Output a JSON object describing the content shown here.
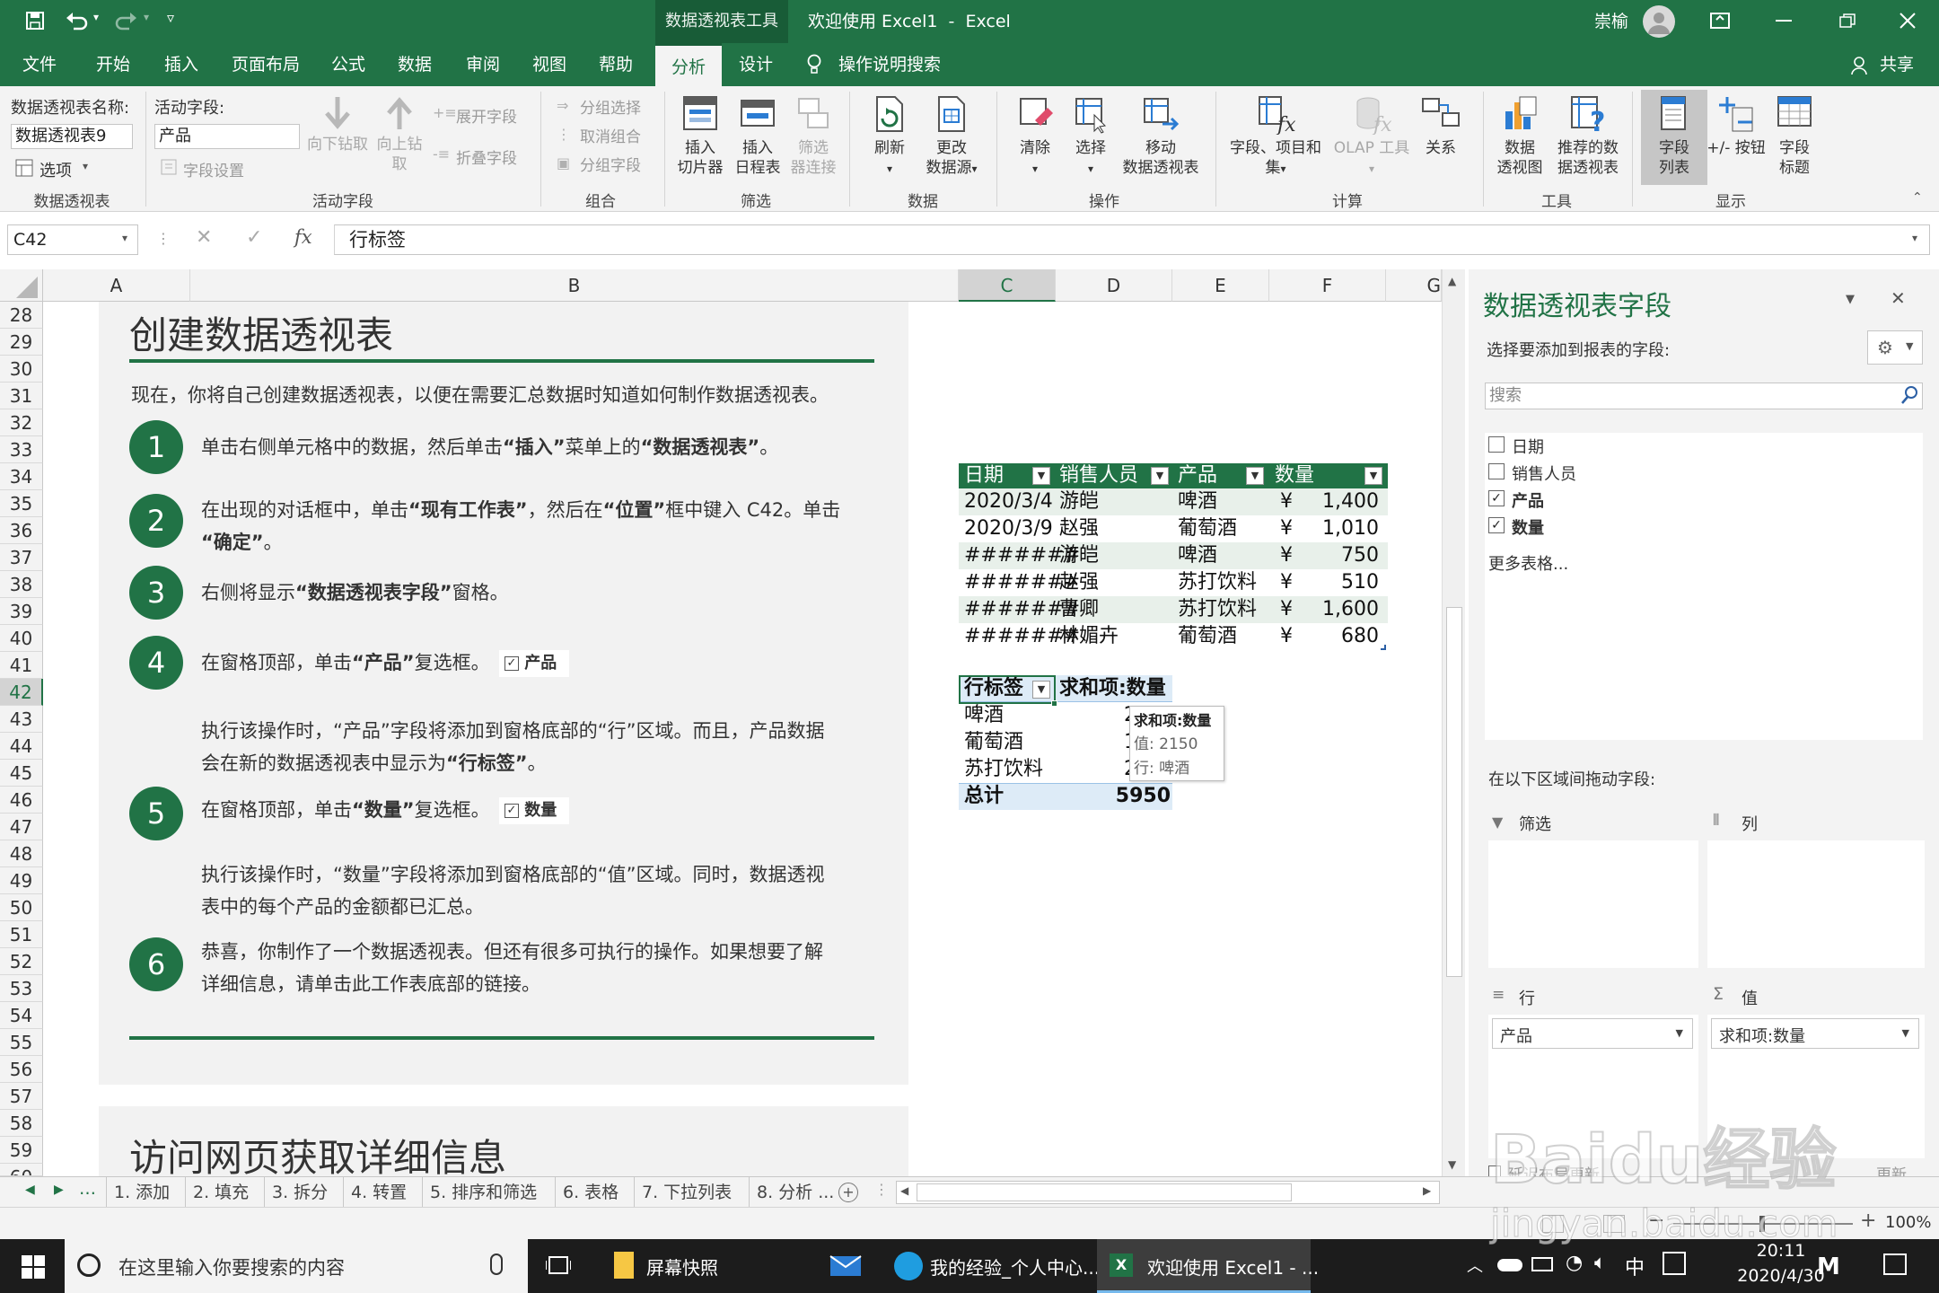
{
  "app": {
    "context_tab": "数据透视表工具",
    "window_title": "欢迎使用 Excel1  -  Excel",
    "user_name": "崇榆"
  },
  "tabs": [
    "文件",
    "开始",
    "插入",
    "页面布局",
    "公式",
    "数据",
    "审阅",
    "视图",
    "帮助",
    "分析",
    "设计"
  ],
  "tell_me": "操作说明搜索",
  "share": "共享",
  "ribbon": {
    "pivot_name_label": "数据透视表名称:",
    "pivot_name_value": "数据透视表9",
    "options_label": "选项",
    "group_pivot": "数据透视表",
    "active_field_label": "活动字段:",
    "active_field_value": "产品",
    "field_settings": "字段设置",
    "drill_down": "向下钻取",
    "drill_up": "向上钻",
    "drill_up2": "取",
    "expand_field": "展开字段",
    "collapse_field": "折叠字段",
    "group_active": "活动字段",
    "group_selection": "分组选择",
    "ungroup": "取消组合",
    "group_field": "分组字段",
    "group_group": "组合",
    "insert_slicer1": "插入",
    "insert_slicer2": "切片器",
    "insert_timeline1": "插入",
    "insert_timeline2": "日程表",
    "filter_conn1": "筛选",
    "filter_conn2": "器连接",
    "group_filter": "筛选",
    "refresh": "刷新",
    "change_src1": "更改",
    "change_src2": "数据源",
    "group_data": "数据",
    "clear": "清除",
    "select": "选择",
    "move1": "移动",
    "move2": "数据透视表",
    "group_actions": "操作",
    "fields_items1": "字段、项目和",
    "fields_items2": "集",
    "olap": "OLAP 工具",
    "relations": "关系",
    "group_calc": "计算",
    "pivotchart1": "数据",
    "pivotchart2": "透视图",
    "recommended1": "推荐的数",
    "recommended2": "据透视表",
    "group_tools": "工具",
    "field_list1": "字段",
    "field_list2": "列表",
    "buttons": "+/- 按钮",
    "headers1": "字段",
    "headers2": "标题",
    "group_show": "显示"
  },
  "formula": {
    "name_box": "C42",
    "fx": "fx",
    "content": "行标签"
  },
  "columns": [
    "A",
    "B",
    "C",
    "D",
    "E",
    "F",
    "G"
  ],
  "rows": [
    "28",
    "29",
    "30",
    "31",
    "32",
    "33",
    "34",
    "35",
    "36",
    "37",
    "38",
    "39",
    "40",
    "41",
    "42",
    "43",
    "44",
    "45",
    "46",
    "47",
    "48",
    "49",
    "50",
    "51",
    "52",
    "53",
    "54",
    "55",
    "56",
    "57",
    "58",
    "59",
    "60"
  ],
  "tutorial": {
    "heading": "创建数据透视表",
    "intro": "现在，你将自己创建数据透视表，以便在需要汇总数据时知道如何制作数据透视表。",
    "steps": [
      {
        "num": "1",
        "a": "单击右侧单元格中的数据，然后单击",
        "b1": "“插入”",
        "c": "菜单上的",
        "b2": "“数据透视表”",
        "d": "。"
      },
      {
        "num": "2",
        "line1a": "在出现的对话框中，单击",
        "line1b": "“现有工作表”",
        "line1c": "，然后在",
        "line1d": "“位置”",
        "line1e": "框中键入 C42。单击",
        "line2": "“确定”",
        "line2e": "。"
      },
      {
        "num": "3",
        "a": "右侧将显示",
        "b": "“数据透视表字段”",
        "c": "窗格。"
      },
      {
        "num": "4",
        "a": "在窗格顶部，单击",
        "b": "“产品”",
        "c": "复选框。",
        "chip": "产品"
      },
      {
        "num": "5",
        "a": "在窗格顶部，单击",
        "b": "“数量”",
        "c": "复选框。",
        "chip": "数量"
      },
      {
        "num": "6",
        "line1": "恭喜，你制作了一个数据透视表。但还有很多可执行的操作。如果想要了解",
        "line2": "详细信息，请单击此工作表底部的链接。"
      }
    ],
    "note4a": "执行该操作时，“产品”字段将添加到窗格底部的“行”区域。而且，产品数据",
    "note4b": "会在新的数据透视表中显示为",
    "note4b_bold": "“行标签”",
    "note4b_end": "。",
    "note5a": "执行该操作时，“数量”字段将添加到窗格底部的“值”区域。同时，数据透视",
    "note5b": "表中的每个产品的金额都已汇总。",
    "heading2": "访问网页获取详细信息"
  },
  "data_table": {
    "headers": [
      "日期",
      "销售人员",
      "产品",
      "数量"
    ],
    "rows": [
      [
        "2020/3/4",
        "游皑",
        "啤酒",
        "¥",
        "1,400"
      ],
      [
        "2020/3/9",
        "赵强",
        "葡萄酒",
        "¥",
        "1,010"
      ],
      [
        "#######",
        "游皑",
        "啤酒",
        "¥",
        "750"
      ],
      [
        "#######",
        "赵强",
        "苏打饮料",
        "¥",
        "510"
      ],
      [
        "#######",
        "曹卿",
        "苏打饮料",
        "¥",
        "1,600"
      ],
      [
        "#######",
        "林媚卉",
        "葡萄酒",
        "¥",
        "680"
      ]
    ]
  },
  "pivot": {
    "row_header": "行标签",
    "value_header": "求和项:数量",
    "rows": [
      {
        "label": "啤酒",
        "value": "2150"
      },
      {
        "label": "葡萄酒",
        "value": "1"
      },
      {
        "label": "苏打饮料",
        "value": "2"
      }
    ],
    "total_label": "总计",
    "total_value": "5950",
    "tooltip": {
      "title": "求和项:数量",
      "line1": "值: 2150",
      "line2": "行: 啤酒"
    }
  },
  "pane": {
    "title": "数据透视表字段",
    "subtitle": "选择要添加到报表的字段:",
    "search_placeholder": "搜索",
    "fields": [
      {
        "label": "日期",
        "checked": false
      },
      {
        "label": "销售人员",
        "checked": false
      },
      {
        "label": "产品",
        "checked": true
      },
      {
        "label": "数量",
        "checked": true
      }
    ],
    "more_tables": "更多表格...",
    "drag_label": "在以下区域间拖动字段:",
    "area_filter": "筛选",
    "area_columns": "列",
    "area_rows": "行",
    "area_values": "值",
    "row_field": "产品",
    "value_field": "求和项:数量",
    "defer_update": "延迟布局更新",
    "update": "更新"
  },
  "sheet_tabs": [
    "1. 添加",
    "2. 填充",
    "3. 拆分",
    "4. 转置",
    "5. 排序和筛选",
    "6. 表格",
    "7. 下拉列表",
    "8. 分析 ..."
  ],
  "status": {
    "zoom": "100%"
  },
  "taskbar": {
    "search_placeholder": "在这里输入你要搜索的内容",
    "apps": [
      "屏幕快照",
      "我的经验_个人中心...",
      "欢迎使用 Excel1 - ..."
    ],
    "ime": "中",
    "time": "20:11",
    "date": "2020/4/30"
  },
  "watermark": "Baidu经验",
  "watermark_url": "jingyan.baidu.com",
  "colors": {
    "excel_green": "#217346",
    "dark_green": "#185c37"
  }
}
